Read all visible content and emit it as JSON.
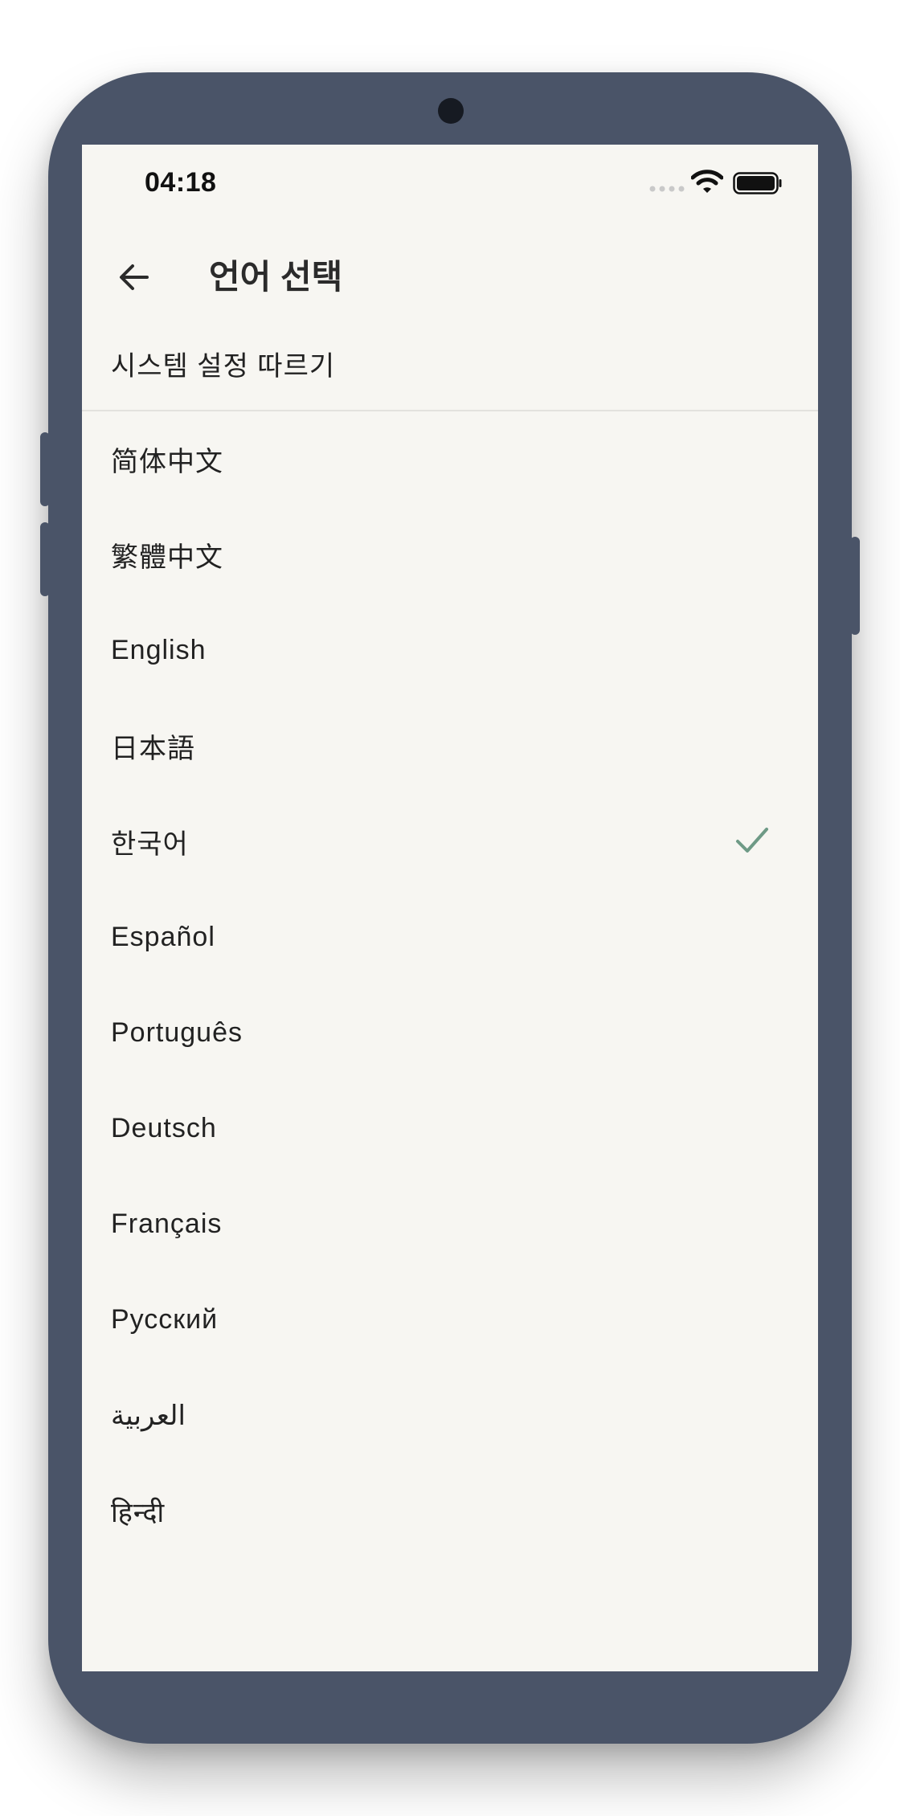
{
  "status_bar": {
    "time": "04:18",
    "icons": [
      "signal-dots-icon",
      "wifi-icon",
      "battery-icon"
    ]
  },
  "app_bar": {
    "back_icon": "arrow-left-icon",
    "title": "언어 선택"
  },
  "system_option": {
    "label": "시스템 설정 따르기"
  },
  "languages": [
    {
      "label": "简体中文",
      "selected": false
    },
    {
      "label": "繁體中文",
      "selected": false
    },
    {
      "label": "English",
      "selected": false
    },
    {
      "label": "日本語",
      "selected": false
    },
    {
      "label": "한국어",
      "selected": true
    },
    {
      "label": "Español",
      "selected": false
    },
    {
      "label": "Português",
      "selected": false
    },
    {
      "label": "Deutsch",
      "selected": false
    },
    {
      "label": "Français",
      "selected": false
    },
    {
      "label": "Русский",
      "selected": false
    },
    {
      "label": "العربية",
      "selected": false
    },
    {
      "label": "हिन्दी",
      "selected": false
    }
  ],
  "colors": {
    "device_frame": "#4a5468",
    "screen_background": "#f7f6f2",
    "check_accent": "#6e9a86",
    "text_primary": "#222222"
  }
}
